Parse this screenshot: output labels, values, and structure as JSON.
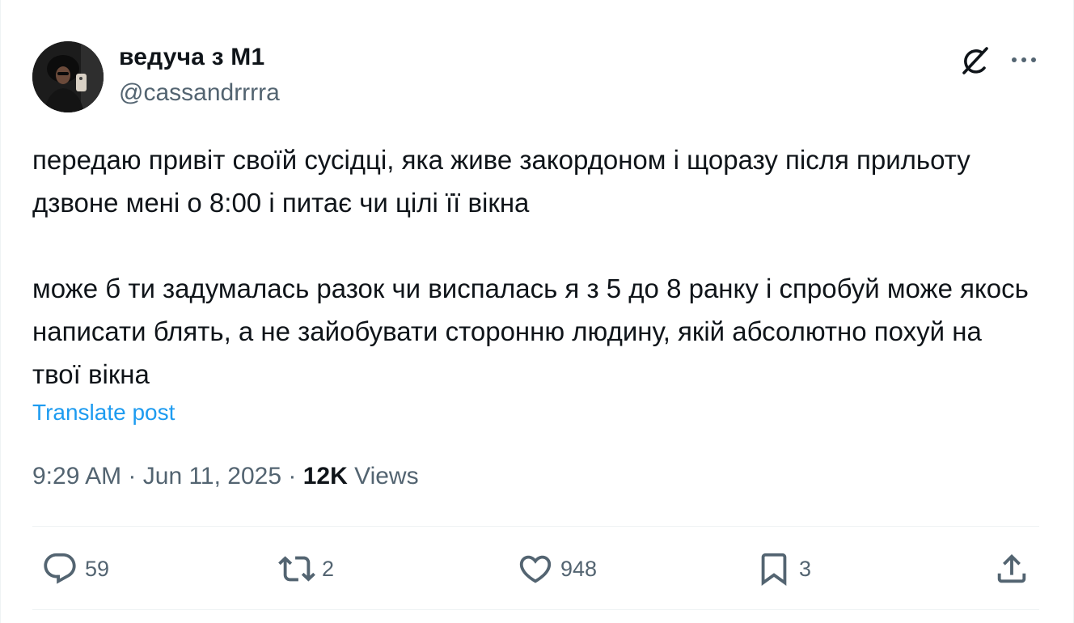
{
  "author": {
    "display_name": "ведуча з М1",
    "handle": "@cassandrrrra"
  },
  "header_actions": {
    "grok_icon": "grok-icon",
    "more_icon": "more-icon"
  },
  "post": {
    "text": "передаю привіт своїй сусідці, яка живе закордоном і щоразу після прильоту дзвоне мені о 8:00 і питає чи цілі її вікна\n\nможе б ти задумалась разок чи виспалась я з 5 до 8 ранку і спробуй може якось написати блять, а не зайобувати сторонню людину, якій абсолютно похуй на твої вікна",
    "translate_label": "Translate post",
    "time": "9:29 AM",
    "separator": "·",
    "date": "Jun 11, 2025",
    "views_count": "12K",
    "views_label": "Views"
  },
  "actions": {
    "replies": "59",
    "reposts": "2",
    "likes": "948",
    "bookmarks": "3"
  },
  "colors": {
    "link": "#1d9bf0",
    "secondary": "#536471",
    "primary": "#0f1419",
    "border": "#eff3f4"
  }
}
